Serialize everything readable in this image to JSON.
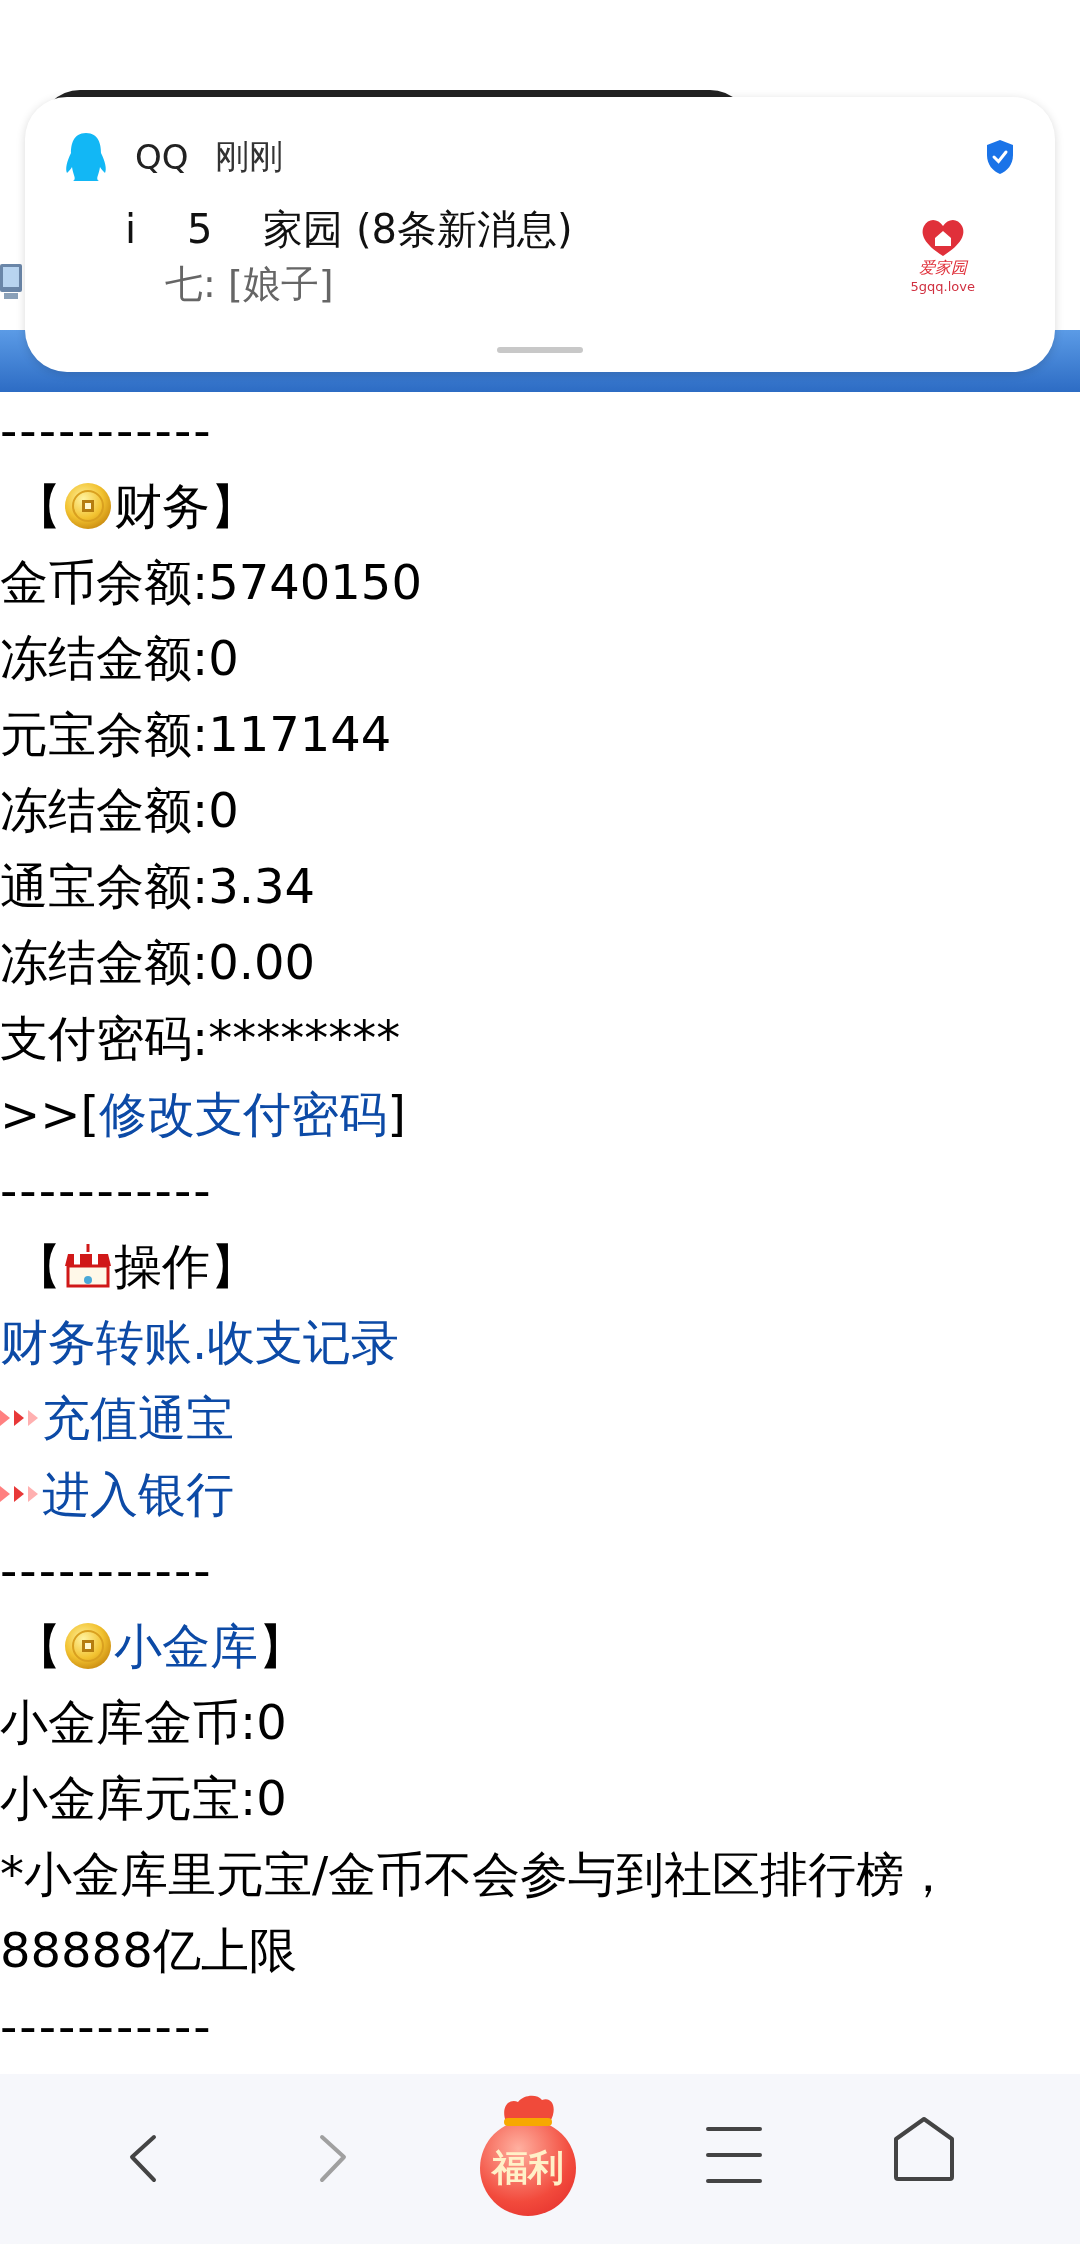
{
  "notification": {
    "app": "QQ",
    "time": "刚刚",
    "title": "i    5    家园 (8条新消息)",
    "message": "七: [娘子]",
    "logo_text": "爱家园",
    "logo_url": "5gqq.love"
  },
  "content": [
    {
      "kind": "divider",
      "text": "-----------"
    },
    {
      "kind": "coin_heading",
      "open": "【",
      "title": "财务",
      "close": "】",
      "is_link": false
    },
    {
      "kind": "text",
      "text": "金币余额:5740150"
    },
    {
      "kind": "text",
      "text": "冻结金额:0"
    },
    {
      "kind": "text",
      "text": "元宝余额:117144"
    },
    {
      "kind": "text",
      "text": "冻结金额:0"
    },
    {
      "kind": "text",
      "text": "通宝余额:3.34"
    },
    {
      "kind": "text",
      "text": "冻结金额:0.00"
    },
    {
      "kind": "text",
      "text": "支付密码:********"
    },
    {
      "kind": "link_line",
      "prefix": ">>[",
      "link": "修改支付密码",
      "suffix": "]"
    },
    {
      "kind": "divider",
      "text": "-----------"
    },
    {
      "kind": "shop_heading",
      "open": "【",
      "title": "操作",
      "close": "】",
      "is_link": false
    },
    {
      "kind": "link",
      "link": "财务转账.收支记录"
    },
    {
      "kind": "arrow_link",
      "link": "充值通宝"
    },
    {
      "kind": "arrow_link",
      "link": "进入银行"
    },
    {
      "kind": "divider",
      "text": "-----------"
    },
    {
      "kind": "coin_heading",
      "open": "【",
      "title": "小金库",
      "close": "】",
      "is_link": true
    },
    {
      "kind": "text",
      "text": "小金库金币:0"
    },
    {
      "kind": "text",
      "text": "小金库元宝:0"
    },
    {
      "kind": "text",
      "text": "*小金库里元宝/金币不会参与到社区排行榜，88888亿上限"
    },
    {
      "kind": "divider",
      "text": "-----------"
    }
  ],
  "toolbar": [
    {
      "kind": "back",
      "disabled": false
    },
    {
      "kind": "forward",
      "disabled": true
    },
    {
      "kind": "gift",
      "label": "福利"
    },
    {
      "kind": "menu"
    },
    {
      "kind": "home"
    }
  ]
}
